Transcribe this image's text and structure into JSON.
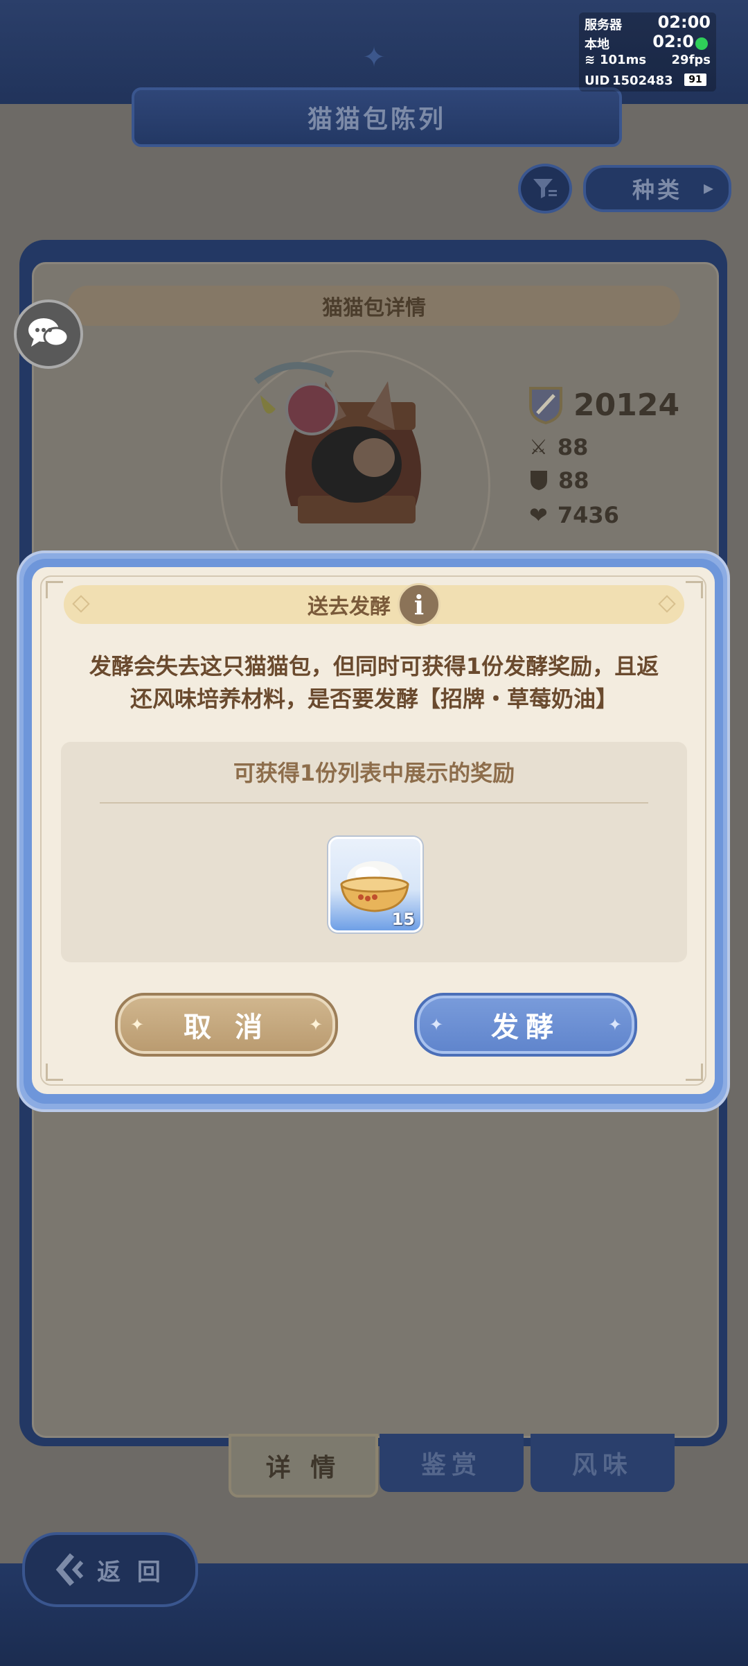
{
  "hud": {
    "server_label": "服务器",
    "server_time": "02:00",
    "local_label": "本地",
    "local_time": "02:0",
    "ping": "101ms",
    "fps": "29fps",
    "uid_label": "UID",
    "uid_value": "1502483",
    "battery": "91"
  },
  "page": {
    "title": "猫猫包陈列",
    "category_label": "种类",
    "detail_header": "猫猫包详情",
    "power": "20124",
    "attack": "88",
    "defense": "88",
    "hp": "7436",
    "tabs": [
      "详 情",
      "鉴赏",
      "风味"
    ],
    "back_label": "返 回"
  },
  "dialog": {
    "title": "送去发酵",
    "info_icon_glyph": "i",
    "message_line1": "发酵会失去这只猫猫包，但同时可获得1份发酵奖励，且返",
    "message_line2": "还风味培养材料，是否要发酵【招牌・草莓奶油】",
    "reward_title": "可获得1份列表中展示的奖励",
    "reward_item_count": "15",
    "cancel_label": "取 消",
    "confirm_label": "发酵"
  },
  "icons": {
    "filter": "filter-icon",
    "chat": "chat-bubble-icon",
    "power": "shield-flag-icon",
    "attack": "crossed-swords-icon",
    "defense": "shield-icon",
    "hp": "heart-icon",
    "back": "back-arrow-icon",
    "reward": "rice-bowl-icon"
  },
  "colors": {
    "dialog_frame": "#6e96da",
    "dialog_bg": "#f3ecdf",
    "cancel_button": "#c5a77c",
    "confirm_button": "#6e90d4",
    "text_brown": "#6a4a2e"
  }
}
